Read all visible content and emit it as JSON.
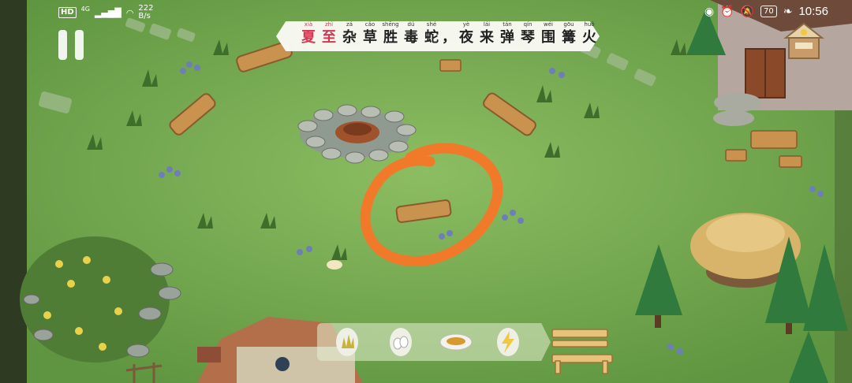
{
  "status_bar": {
    "hd": "HD",
    "network": "4G",
    "speed_value": "222",
    "speed_unit": "B/s",
    "battery": "70",
    "time": "10:56"
  },
  "poem": {
    "chars": [
      {
        "py": "xià",
        "hz": "夏",
        "highlight": true
      },
      {
        "py": "zhì",
        "hz": "至",
        "highlight": true
      },
      {
        "py": "zá",
        "hz": "杂"
      },
      {
        "py": "cǎo",
        "hz": "草"
      },
      {
        "py": "shēng",
        "hz": "胜"
      },
      {
        "py": "dú",
        "hz": "毒"
      },
      {
        "py": "shé",
        "hz": "蛇"
      },
      {
        "py": "",
        "hz": "，",
        "sep": true
      },
      {
        "py": "yè",
        "hz": "夜"
      },
      {
        "py": "lái",
        "hz": "来"
      },
      {
        "py": "tán",
        "hz": "弹"
      },
      {
        "py": "qín",
        "hz": "琴"
      },
      {
        "py": "wéi",
        "hz": "围"
      },
      {
        "py": "gōu",
        "hz": "篝"
      },
      {
        "py": "huǒ",
        "hz": "火"
      }
    ]
  },
  "toolbar": {
    "items": [
      "grass-egg-icon",
      "white-eggs-icon",
      "food-plate-icon",
      "lightning-egg-icon"
    ]
  },
  "colors": {
    "grass": "#7bb055",
    "highlight_circle": "#f07a2a",
    "poem_highlight": "#d6364f"
  }
}
